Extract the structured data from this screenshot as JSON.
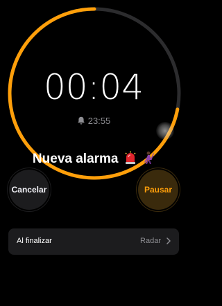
{
  "timer": {
    "remaining": "00:04",
    "end_time": "23:55",
    "progress_fraction": 0.72,
    "ring_color": "#ff9f0a",
    "track_color": "#2c2c2e"
  },
  "caption": {
    "text": "Nueva alarma",
    "emojis": [
      "siren-emoji",
      "dancer-emoji"
    ]
  },
  "controls": {
    "cancel_label": "Cancelar",
    "pause_label": "Pausar"
  },
  "on_end": {
    "label": "Al finalizar",
    "value": "Radar"
  },
  "icons": {
    "bell": "bell-icon",
    "chevron": "chevron-right-icon"
  }
}
